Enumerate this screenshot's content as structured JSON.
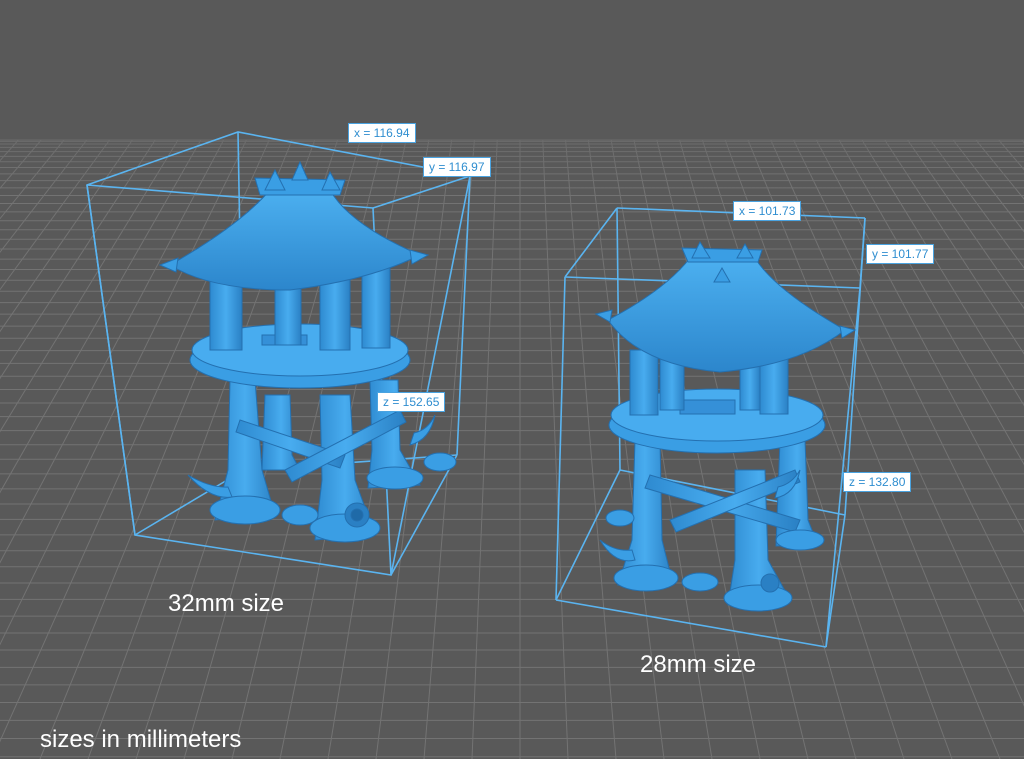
{
  "colors": {
    "background": "#595959",
    "grid": "#7a7a7a",
    "model": "#3a9ee4",
    "bounding_box": "#5ab4f0",
    "label_text": "#2f8ed0"
  },
  "models": [
    {
      "id": "large",
      "dimensions": {
        "x": "x = 116.94",
        "y": "y = 116.97",
        "z": "z = 152.65"
      },
      "caption": "32mm size"
    },
    {
      "id": "small",
      "dimensions": {
        "x": "x = 101.73",
        "y": "y = 101.77",
        "z": "z = 132.80"
      },
      "caption": "28mm size"
    }
  ],
  "footer_note": "sizes in millimeters"
}
